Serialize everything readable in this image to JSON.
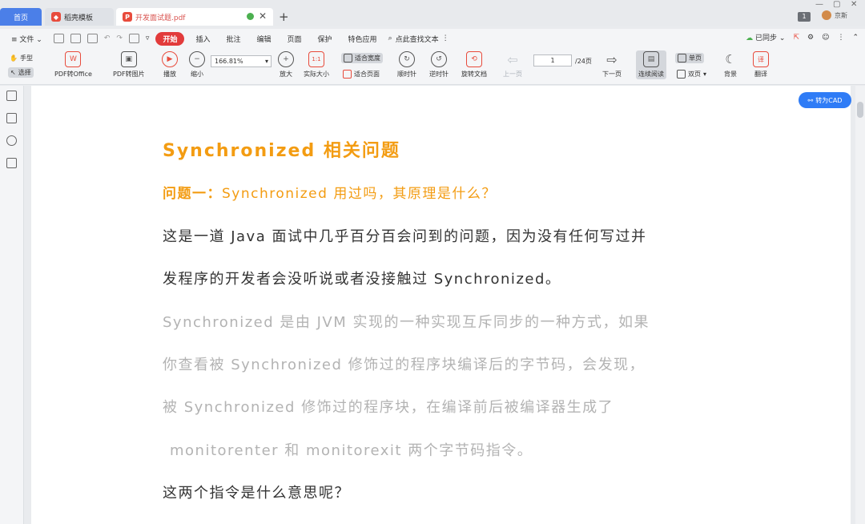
{
  "tabs": {
    "home": "首页",
    "template": "稻壳模板",
    "document": "开发面试题.pdf",
    "page_badge": "1",
    "user": "京斯"
  },
  "menubar": {
    "file": "文件",
    "items": [
      "开始",
      "插入",
      "批注",
      "编辑",
      "页面",
      "保护",
      "特色应用"
    ],
    "search": "点此查找文本",
    "sync": "已同步"
  },
  "toolbar": {
    "hand": "手型",
    "select": "选择",
    "pdf_to_office": "PDF转Office",
    "pdf_to_image": "PDF转图片",
    "play": "播放",
    "zoom_out": "缩小",
    "zoom_value": "166.81%",
    "zoom_in": "放大",
    "actual_size": "实际大小",
    "fit_width": "适合宽度",
    "fit_page": "适合页面",
    "rotate_cw": "顺时针",
    "rotate_ccw": "逆时针",
    "rotate_doc": "旋转文档",
    "prev_page": "上一页",
    "page_current": "1",
    "page_total": "/24页",
    "next_page": "下一页",
    "continuous": "连续阅读",
    "single": "单页",
    "double": "双页",
    "background": "背景",
    "translate": "翻译"
  },
  "cad_button": "转为CAD",
  "document": {
    "title": "Synchronized  相关问题",
    "q1_label": "问题一：",
    "q1_text": "Synchronized  用过吗，其原理是什么？",
    "p1_line1": "这是一道  Java  面试中几乎百分百会问到的问题，因为没有任何写过并",
    "p1_line2": "发程序的开发者会没听说或者没接触过  Synchronized。",
    "p2_line1": "Synchronized  是由  JVM  实现的一种实现互斥同步的一种方式，如果",
    "p2_line2": "你查看被   Synchronized   修饰过的程序块编译后的字节码，会发现，",
    "p2_line3": "被      Synchronized      修饰过的程序块，在编译前后被编译器生成了",
    "p2_line4": "monitorenter  和  monitorexit  两个字节码指令。",
    "p3_line1": "这两个指令是什么意思呢？"
  }
}
